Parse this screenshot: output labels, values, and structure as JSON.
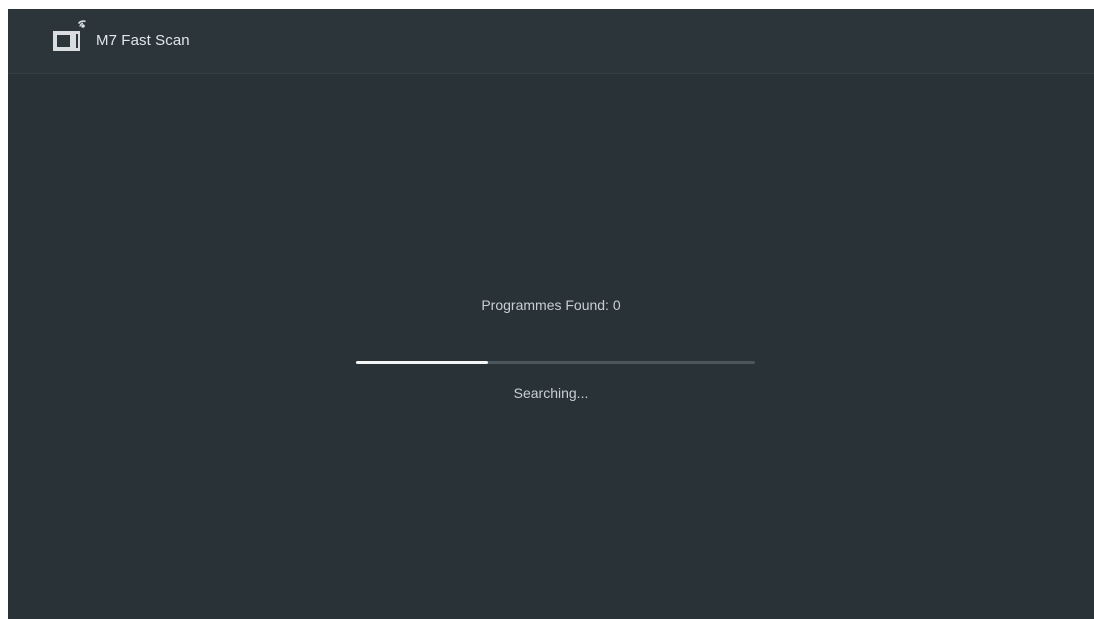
{
  "header": {
    "icon": "tv-antenna-icon",
    "title": "M7 Fast Scan"
  },
  "scan": {
    "found_text": "Programmes Found: 0",
    "progress_fraction": 0.33,
    "status_text": "Searching..."
  },
  "colors": {
    "background": "#283237",
    "progress_fill": "#f4f6f6",
    "progress_track": "#4a565b"
  }
}
